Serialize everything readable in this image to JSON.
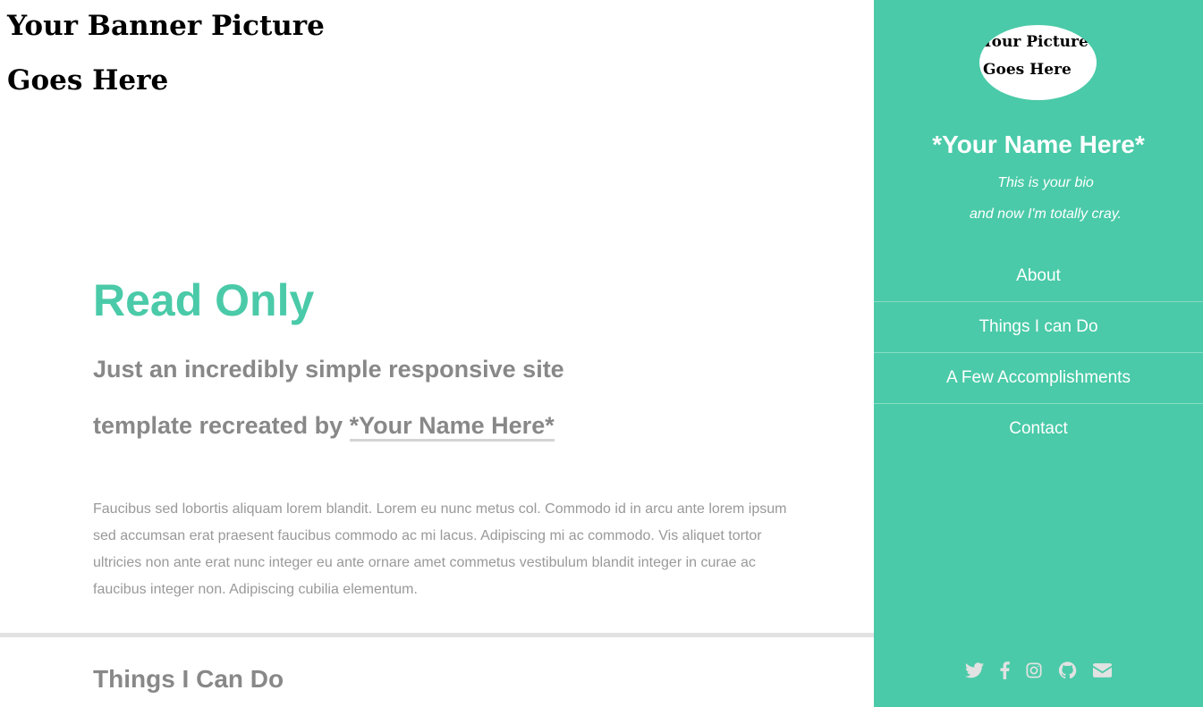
{
  "banner": {
    "line1": "Your Banner Picture",
    "line2": "Goes Here"
  },
  "hero": {
    "title": "Read Only",
    "tagline_line1": "Just an incredibly simple responsive site",
    "tagline_line2_prefix": "template recreated by ",
    "tagline_link": "*Your Name Here*"
  },
  "intro": {
    "text": "Faucibus sed lobortis aliquam lorem blandit. Lorem eu nunc metus col. Commodo id in arcu ante lorem ipsum sed accumsan erat praesent faucibus commodo ac mi lacus. Adipiscing mi ac commodo. Vis aliquet tortor ultricies non ante erat nunc integer eu ante ornare amet commetus vestibulum blandit integer in curae ac faucibus integer non. Adipiscing cubilia elementum."
  },
  "section": {
    "title": "Things I Can Do"
  },
  "sidebar": {
    "avatar_line1": "Your Picture",
    "avatar_line2": "Goes Here",
    "name": "*Your Name Here*",
    "bio_line1": "This is your bio",
    "bio_line2": "and now I'm totally cray.",
    "nav": [
      {
        "label": "About"
      },
      {
        "label": "Things I can Do"
      },
      {
        "label": "A Few Accomplishments"
      },
      {
        "label": "Contact"
      }
    ],
    "social_icons": [
      "twitter-icon",
      "facebook-icon",
      "instagram-icon",
      "github-icon",
      "email-icon"
    ]
  },
  "colors": {
    "accent": "#4acaa8",
    "muted_text": "#888888",
    "body_text": "#999999",
    "social_icon": "#e2e2e2"
  }
}
